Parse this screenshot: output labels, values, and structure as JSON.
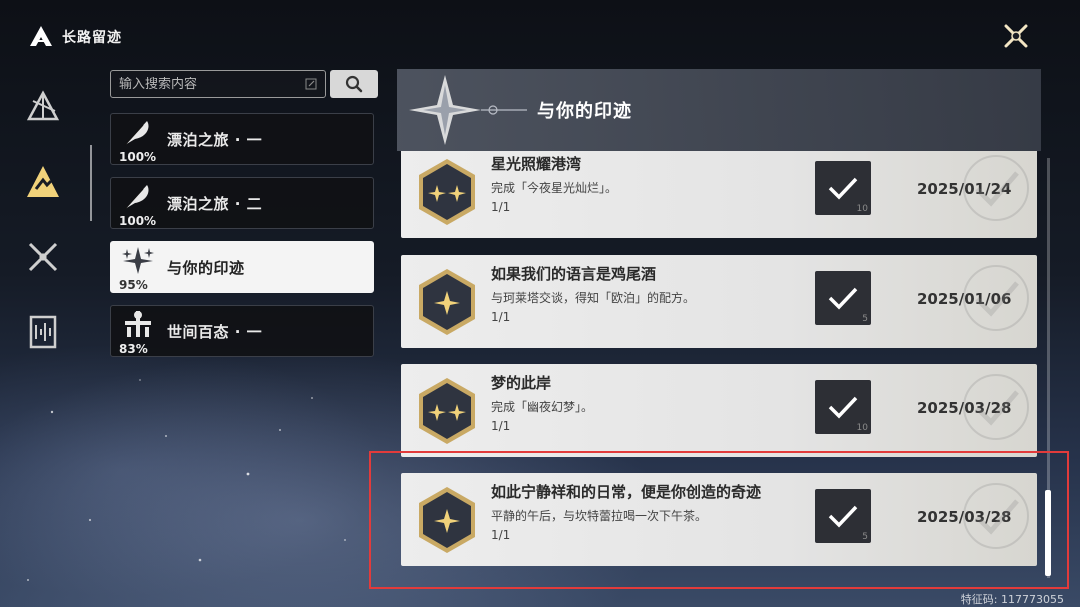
{
  "header": {
    "title": "长路留迹",
    "icon": "trailblaze-logo-icon"
  },
  "close_button": {
    "icon": "close-icon"
  },
  "rail": {
    "items": [
      {
        "icon": "trailblaze-emblem-icon"
      },
      {
        "icon": "path-marker-icon",
        "active": true
      },
      {
        "icon": "crossed-swords-icon"
      },
      {
        "icon": "book-icon"
      }
    ]
  },
  "search": {
    "placeholder": "输入搜索内容",
    "value": ""
  },
  "albums": [
    {
      "name": "漂泊之旅 · 一",
      "percent": "100%",
      "icon": "feather-icon"
    },
    {
      "name": "漂泊之旅 · 二",
      "percent": "100%",
      "icon": "feather-icon"
    },
    {
      "name": "与你的印迹",
      "percent": "95%",
      "icon": "sparkle-icon",
      "active": true
    },
    {
      "name": "世间百态 · 一",
      "percent": "83%",
      "icon": "city-icon"
    }
  ],
  "panel": {
    "title": "与你的印迹"
  },
  "achievements": [
    {
      "name": "星光照耀港湾",
      "desc": "完成「今夜星光灿烂」。",
      "progress": "1/1",
      "reward": "10",
      "date": "2025/01/24",
      "stars": 2
    },
    {
      "name": "如果我们的语言是鸡尾酒",
      "desc": "与珂莱塔交谈，得知「欧泊」的配方。",
      "progress": "1/1",
      "reward": "5",
      "date": "2025/01/06",
      "stars": 1
    },
    {
      "name": "梦的此岸",
      "desc": "完成「幽夜幻梦」。",
      "progress": "1/1",
      "reward": "10",
      "date": "2025/03/28",
      "stars": 2
    },
    {
      "name": "如此宁静祥和的日常，便是你创造的奇迹",
      "desc": "平静的午后，与坎特蕾拉喝一次下午茶。",
      "progress": "1/1",
      "reward": "5",
      "date": "2025/03/28",
      "stars": 1
    }
  ],
  "uid": "特征码: 117773055",
  "colors": {
    "highlight": "#e23b3b",
    "active_album_bg": "#f4f4f4",
    "badge_gold": "#f1d27a"
  }
}
